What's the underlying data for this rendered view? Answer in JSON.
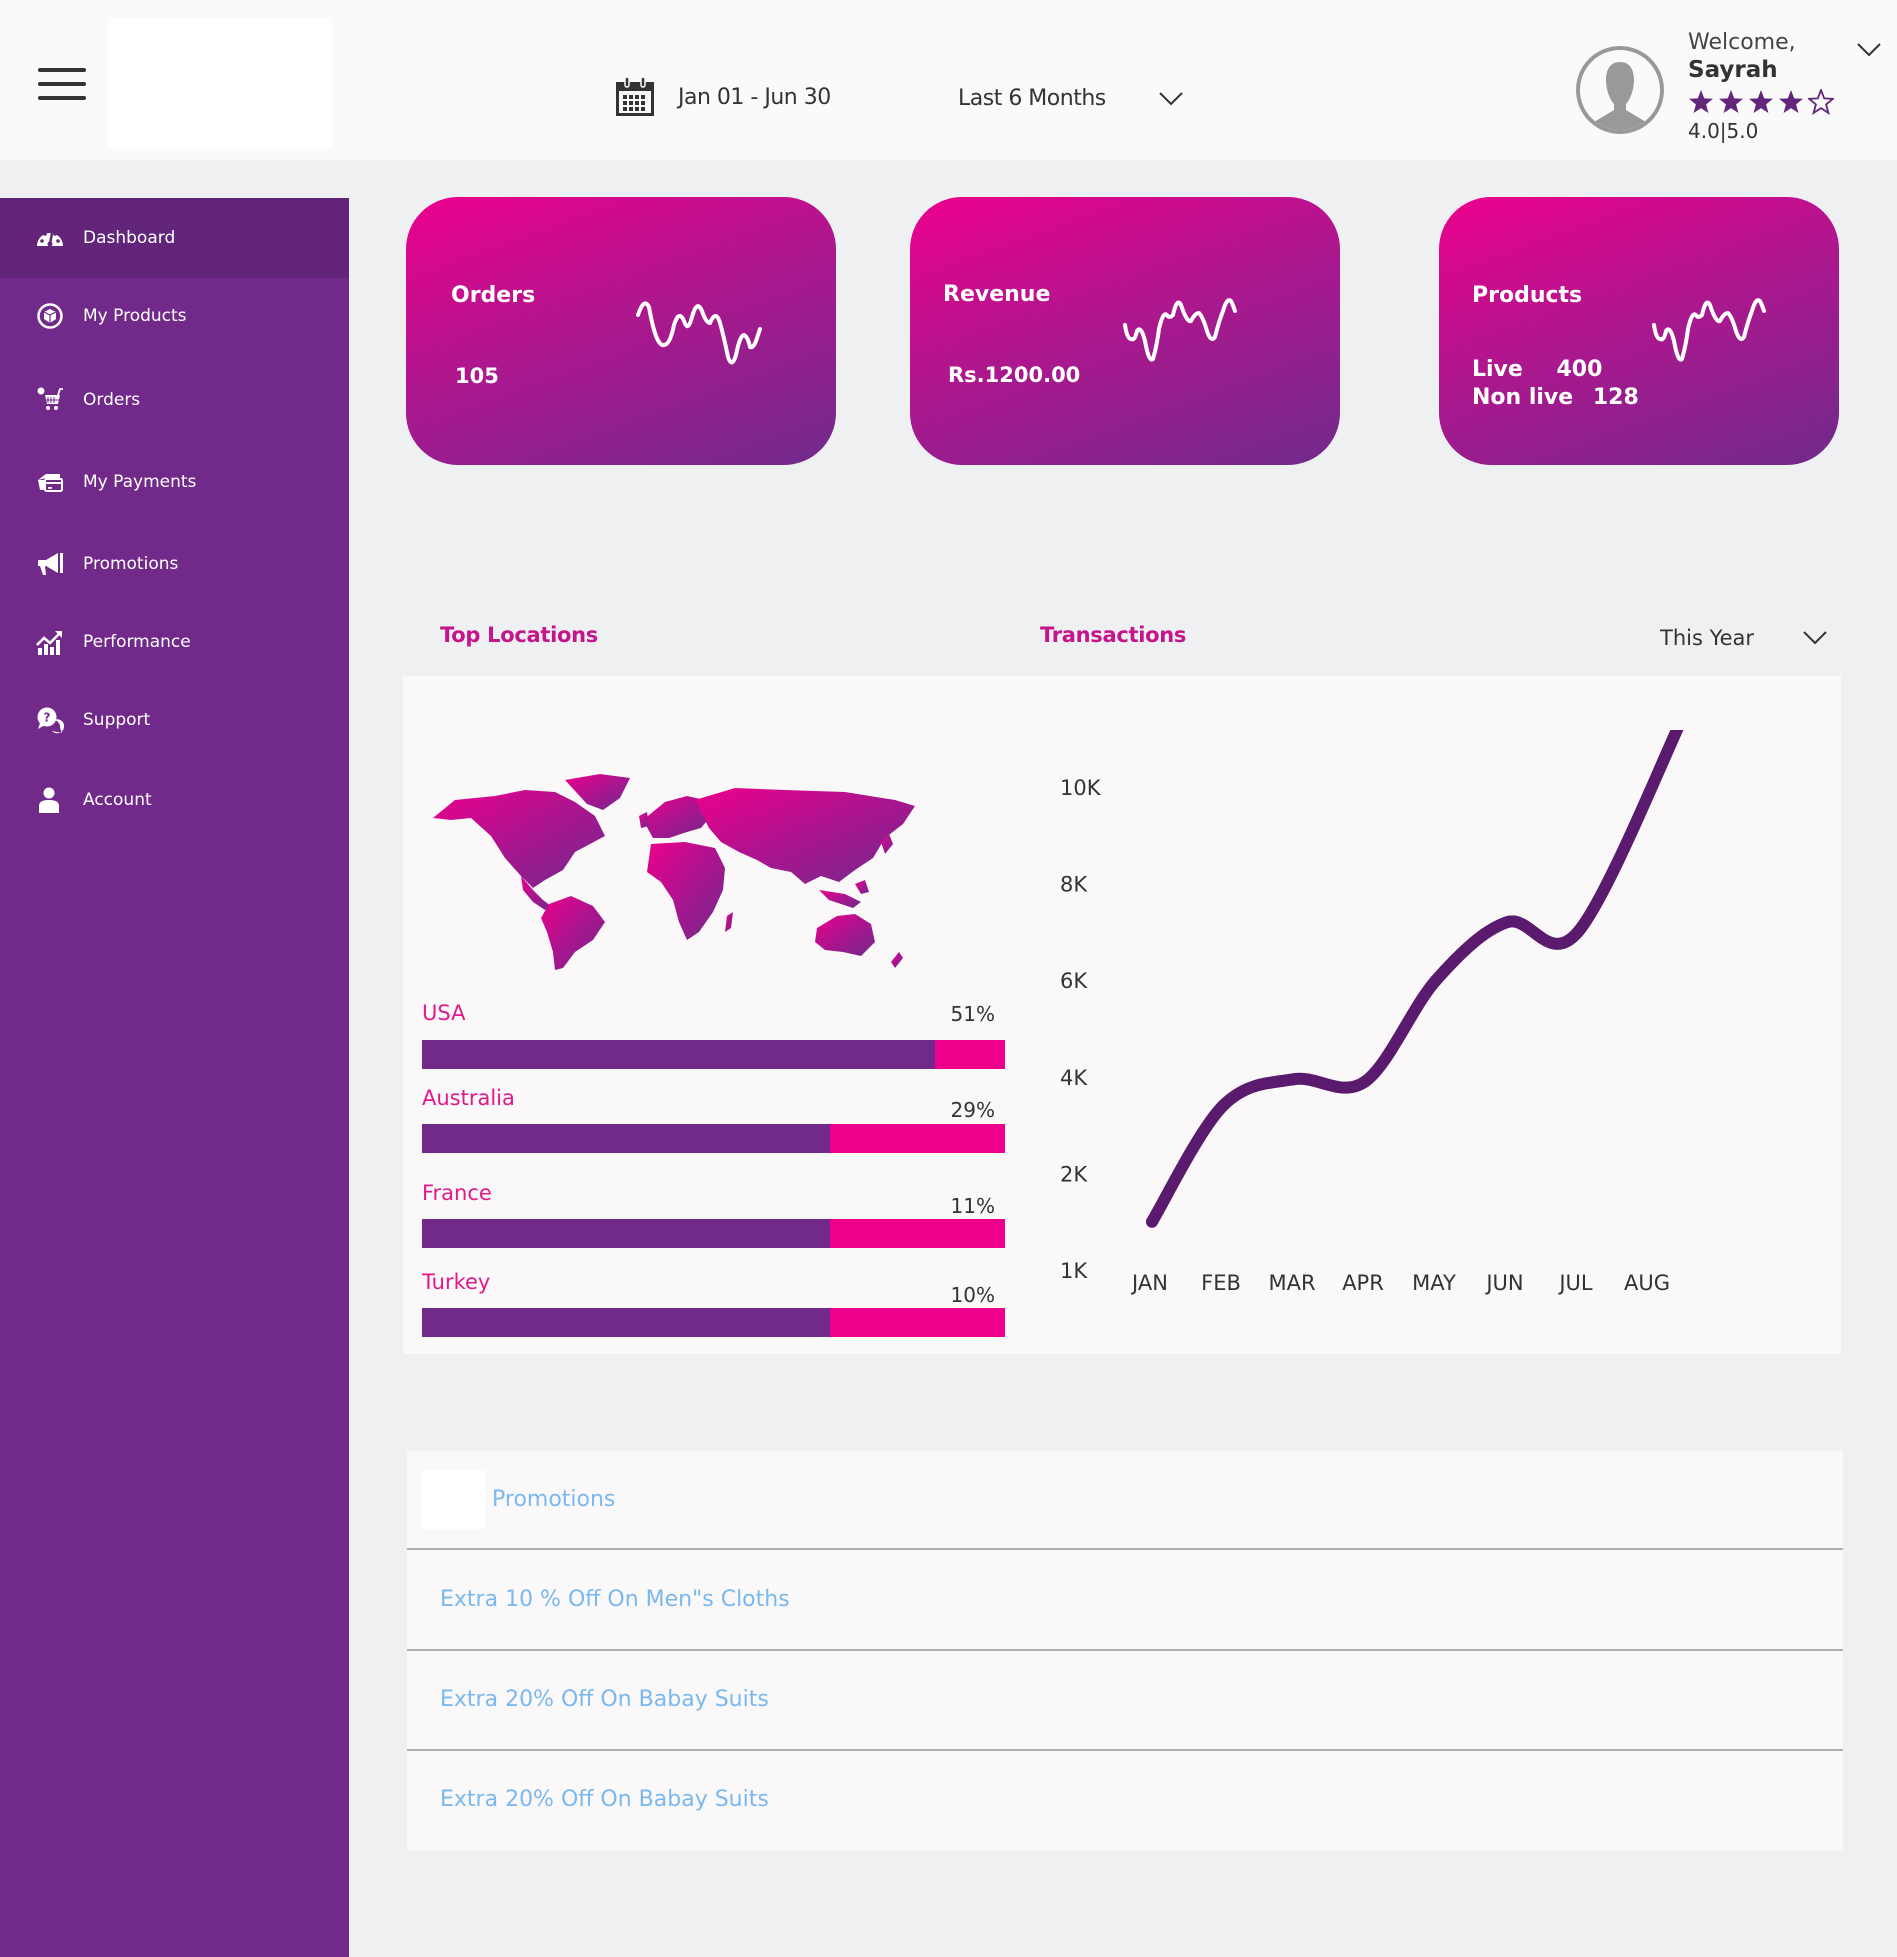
{
  "header": {
    "date_range": "Jan 01 - Jun 30",
    "period_select": "Last 6 Months",
    "user": {
      "welcome": "Welcome,",
      "name": "Sayrah",
      "rating_value": 4.0,
      "rating_max": 5,
      "rating_text": "4.0|5.0"
    }
  },
  "sidebar": {
    "items": [
      {
        "label": "Dashboard",
        "icon": "dashboard-gauge-icon",
        "active": true
      },
      {
        "label": "My Products",
        "icon": "product-box-icon",
        "active": false
      },
      {
        "label": "Orders",
        "icon": "shopping-cart-icon",
        "active": false
      },
      {
        "label": "My Payments",
        "icon": "payment-card-icon",
        "active": false
      },
      {
        "label": "Promotions",
        "icon": "megaphone-icon",
        "active": false
      },
      {
        "label": "Performance",
        "icon": "performance-chart-icon",
        "active": false
      },
      {
        "label": "Support",
        "icon": "support-chat-icon",
        "active": false
      },
      {
        "label": "Account",
        "icon": "user-icon",
        "active": false
      }
    ]
  },
  "cards": {
    "orders": {
      "title": "Orders",
      "value": "105"
    },
    "revenue": {
      "title": "Revenue",
      "value": "Rs.1200.00"
    },
    "products": {
      "title": "Products",
      "live_label": "Live",
      "live_value": "400",
      "nonlive_label": "Non live",
      "nonlive_value": "128"
    }
  },
  "sections": {
    "top_locations": "Top Locations",
    "transactions": "Transactions",
    "year_select": "This Year"
  },
  "locations": [
    {
      "name": "USA",
      "percent_label": "51%",
      "bar_fill": 0.88
    },
    {
      "name": "Australia",
      "percent_label": "29%",
      "bar_fill": 0.7
    },
    {
      "name": "France",
      "percent_label": "11%",
      "bar_fill": 0.7
    },
    {
      "name": "Turkey",
      "percent_label": "10%",
      "bar_fill": 0.7
    }
  ],
  "promotions": {
    "title": "Promotions",
    "items": [
      "Extra 10 % Off On Men\"s  Cloths",
      "Extra 20% Off On Babay Suits",
      "Extra 20% Off On Babay Suits"
    ]
  },
  "colors": {
    "sidebar": "#722a8a",
    "sidebar_active": "#62257a",
    "accent_magenta": "#ec008c",
    "accent_purple": "#722a8a",
    "chart_line": "#5a1a6e",
    "heading": "#c4158a",
    "promo_text": "#7ab8f0"
  },
  "chart_data": {
    "type": "line",
    "title": "Transactions",
    "categories": [
      "JAN",
      "FEB",
      "MAR",
      "APR",
      "MAY",
      "JUN",
      "JUL",
      "AUG"
    ],
    "y_ticks": [
      "1K",
      "2K",
      "4K",
      "6K",
      "8K",
      "10K"
    ],
    "series": [
      {
        "name": "Transactions",
        "values": [
          1500,
          3400,
          3950,
          3900,
          6000,
          7200,
          7000,
          11500
        ]
      }
    ],
    "xlabel": "",
    "ylabel": "",
    "grid": false,
    "smooth": true
  }
}
